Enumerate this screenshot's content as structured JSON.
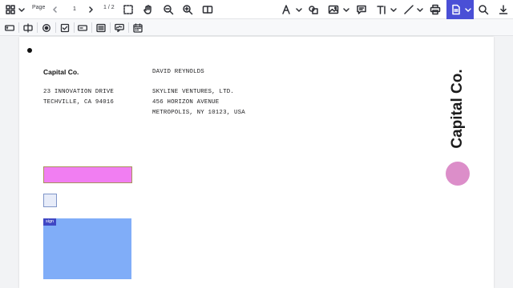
{
  "toolbar": {
    "page_label": "Page",
    "page_value": "1",
    "page_total": "1 / 2",
    "icons": [
      "grid-icon",
      "chevron-down-icon",
      "chevron-left-icon",
      "chevron-right-icon",
      "marquee-select-icon",
      "hand-pan-icon",
      "zoom-out-icon",
      "zoom-in-icon",
      "two-page-view-icon",
      "pen-icon",
      "shape-icon",
      "image-icon",
      "comment-icon",
      "text-icon",
      "line-icon",
      "print-icon",
      "document-icon",
      "search-icon",
      "download-icon"
    ]
  },
  "form_toolbar": {
    "icons": [
      "text-field-icon",
      "combo-box-icon",
      "radio-button-icon",
      "checkbox-icon",
      "button-field-icon",
      "list-box-icon",
      "signature-field-icon",
      "date-field-icon"
    ]
  },
  "document": {
    "sender": {
      "name": "Capital Co.",
      "address_line1": "23 INNOVATION DRIVE",
      "address_line2": "TECHVILLE, CA 94016"
    },
    "recipient": {
      "name": "DAVID REYNOLDS",
      "company": "SKYLINE VENTURES, LTD.",
      "address_line1": "456 HORIZON AVENUE",
      "address_line2": "METROPOLIS, NY 10123, USA"
    },
    "logo_text": "Capital Co.",
    "sign_tag": "sign"
  },
  "colors": {
    "accent": "#4a4fd6",
    "text_field": "#f17ef2",
    "signature_field": "#80adf8",
    "logo_circle": "#dc8ec9"
  }
}
